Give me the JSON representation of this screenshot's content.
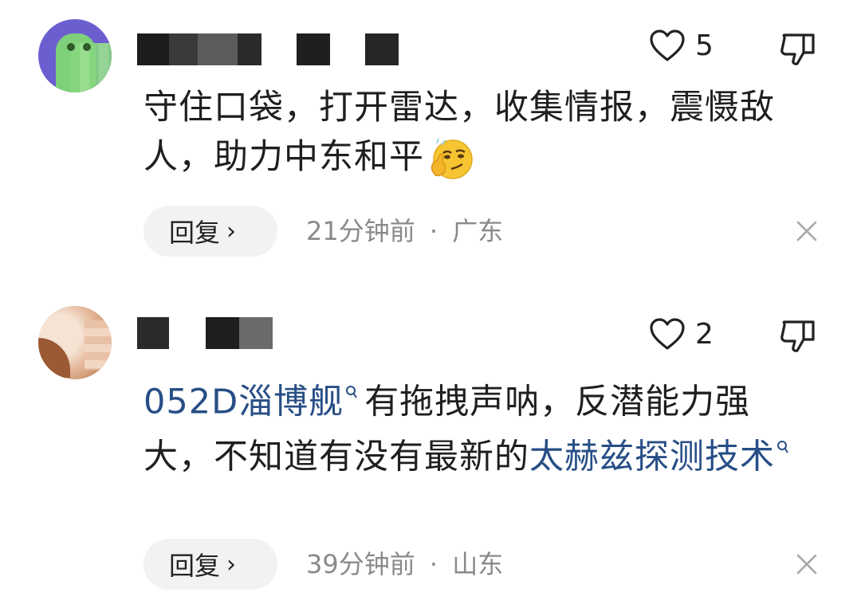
{
  "comments": [
    {
      "likes": "5",
      "text": "守住口袋，打开雷达，收集情报，震慑敌人，助力中东和平",
      "emoji": "thinking-smirk-emoji",
      "reply_label": "回复",
      "reply_chevron": "›",
      "time": "21分钟前",
      "separator": "·",
      "location": "广东"
    },
    {
      "likes": "2",
      "link1": "052D淄博舰",
      "text_mid": "有拖拽声呐，反潜能力强大，不知道有没有最新的",
      "link2": "太赫兹探测技术",
      "reply_label": "回复",
      "reply_chevron": "›",
      "time": "39分钟前",
      "separator": "·",
      "location": "山东"
    }
  ],
  "icons": {
    "like": "heart-outline-icon",
    "dislike": "thumbs-down-outline-icon",
    "close": "close-icon",
    "search": "search-icon"
  },
  "colors": {
    "link": "#274e86",
    "meta": "#8a8a8a",
    "reply_bg": "#f2f2f2"
  }
}
